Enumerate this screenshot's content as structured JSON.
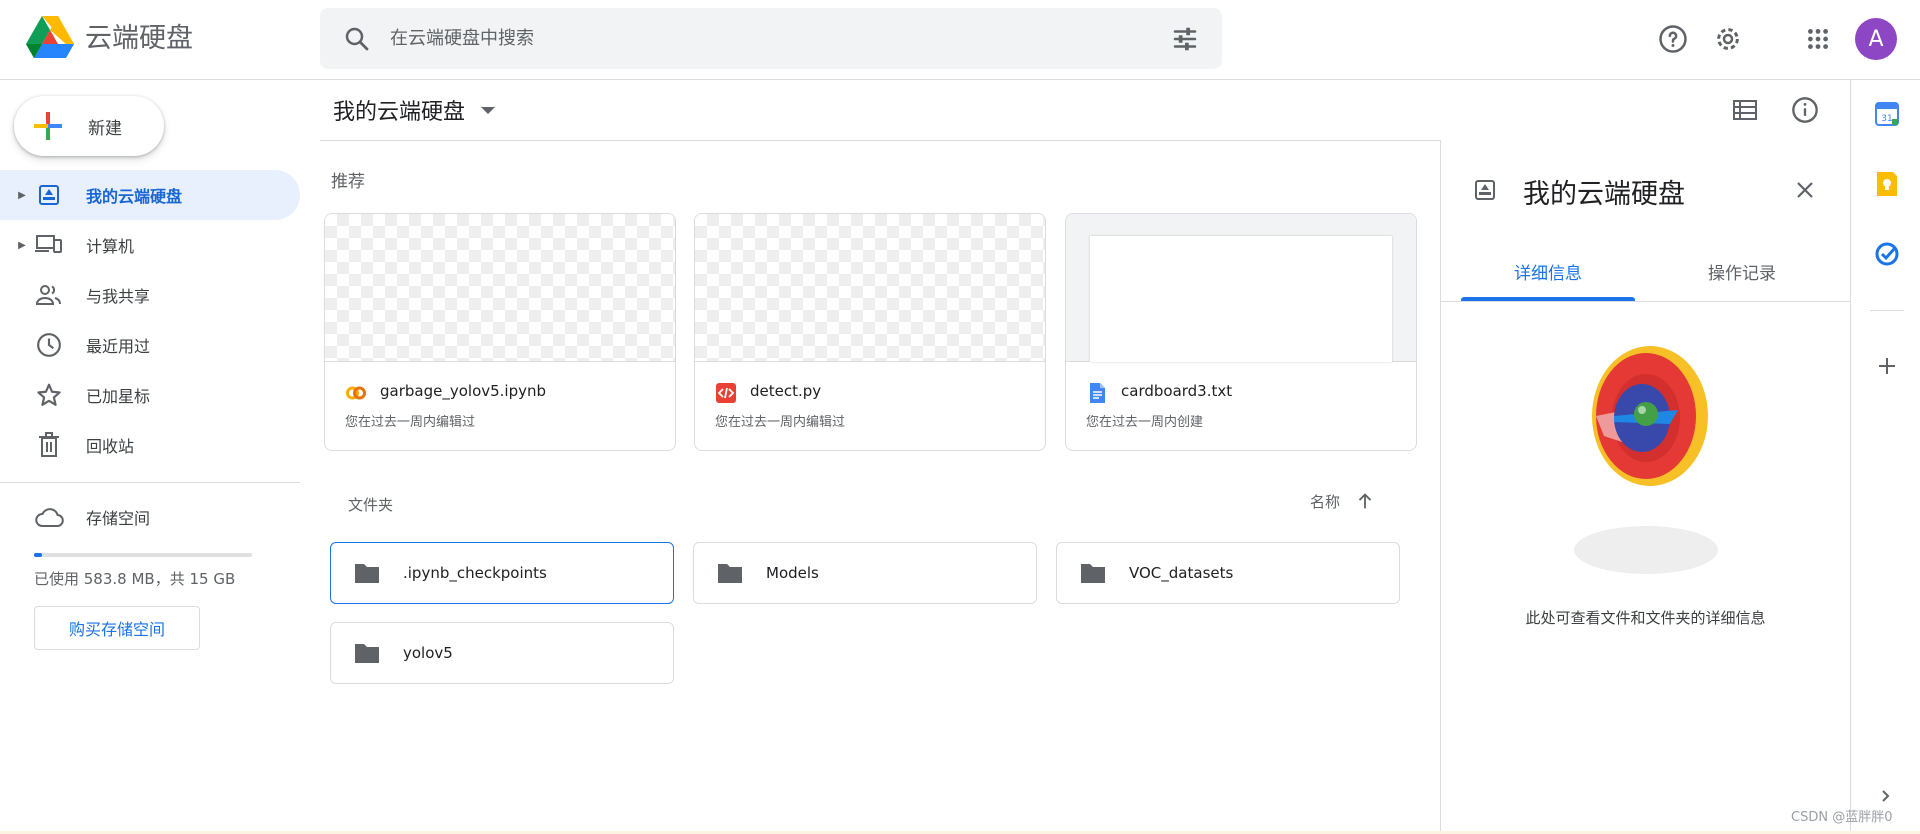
{
  "app": {
    "title": "云端硬盘"
  },
  "search": {
    "placeholder": "在云端硬盘中搜索"
  },
  "header": {
    "avatar_letter": "A",
    "icons": [
      "help-icon",
      "settings-icon",
      "apps-icon"
    ]
  },
  "sidebar": {
    "new_label": "新建",
    "items": [
      {
        "label": "我的云端硬盘",
        "icon": "my-drive-icon",
        "active": true
      },
      {
        "label": "计算机",
        "icon": "computers-icon"
      },
      {
        "label": "与我共享",
        "icon": "shared-icon"
      },
      {
        "label": "最近用过",
        "icon": "clock-icon"
      },
      {
        "label": "已加星标",
        "icon": "star-icon"
      },
      {
        "label": "回收站",
        "icon": "trash-icon"
      }
    ],
    "storage": {
      "label": "存储空间",
      "usage_text": "已使用 583.8 MB，共 15 GB",
      "used_fraction": 0.038,
      "buy_label": "购买存储空间"
    }
  },
  "main": {
    "title": "我的云端硬盘",
    "suggested_label": "推荐",
    "suggested": [
      {
        "name": "garbage_yolov5.ipynb",
        "sub": "您在过去一周内编辑过",
        "icon": "colab-icon"
      },
      {
        "name": "detect.py",
        "sub": "您在过去一周内编辑过",
        "icon": "code-file-icon"
      },
      {
        "name": "cardboard3.txt",
        "sub": "您在过去一周内创建",
        "icon": "doc-icon"
      }
    ],
    "folders_label": "文件夹",
    "sort_label": "名称",
    "folders": [
      {
        "name": ".ipynb_checkpoints",
        "selected": true
      },
      {
        "name": "Models"
      },
      {
        "name": "VOC_datasets"
      },
      {
        "name": "yolov5"
      }
    ]
  },
  "details": {
    "title": "我的云端硬盘",
    "tabs": [
      "详细信息",
      "操作记录"
    ],
    "active_tab": 0,
    "hint": "此处可查看文件和文件夹的详细信息"
  },
  "watermark": "CSDN @蓝胖胖0",
  "colors": {
    "accent": "#1a73e8",
    "active_bg": "#e8f0fe",
    "avatar": "#8e47c4"
  }
}
